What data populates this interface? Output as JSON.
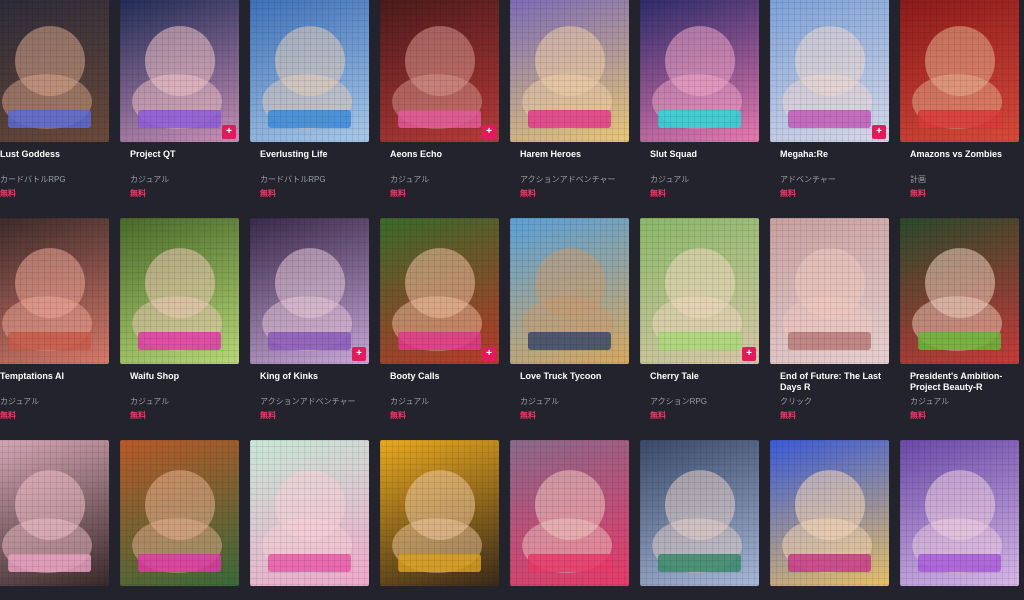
{
  "badge_glyph": "+",
  "rows": [
    [
      {
        "title": "Lust Goddess",
        "genre": "カードバトルRPG",
        "price": "無料",
        "badge": false,
        "bg": [
          "#2a2a3a",
          "#6b4a3a"
        ],
        "blob": "#d9a68a",
        "band": "#5a6bd8"
      },
      {
        "title": "Project QT",
        "genre": "カジュアル",
        "price": "無料",
        "badge": true,
        "bg": [
          "#1e2b55",
          "#c890b8"
        ],
        "blob": "#f2c4c8",
        "band": "#8c5ad8"
      },
      {
        "title": "Everlusting Life",
        "genre": "カードバトルRPG",
        "price": "無料",
        "badge": false,
        "bg": [
          "#3c6fb8",
          "#a9c9e8"
        ],
        "blob": "#e8cdb8",
        "band": "#3b8ad8"
      },
      {
        "title": "Aeons Echo",
        "genre": "カジュアル",
        "price": "無料",
        "badge": true,
        "bg": [
          "#4a1a1a",
          "#b83a3a"
        ],
        "blob": "#d89890",
        "band": "#e25a9a"
      },
      {
        "title": "Harem Heroes",
        "genre": "アクションアドベンチャー",
        "price": "無料",
        "badge": false,
        "bg": [
          "#7a6ab8",
          "#e8c878"
        ],
        "blob": "#f0d0a8",
        "band": "#e23a8a"
      },
      {
        "title": "Slut Squad",
        "genre": "カジュアル",
        "price": "無料",
        "badge": false,
        "bg": [
          "#2a2a6a",
          "#e87ab0"
        ],
        "blob": "#f2a8c8",
        "band": "#2ad8d8"
      },
      {
        "title": "Megaha:Re",
        "genre": "アドベンチャー",
        "price": "無料",
        "badge": true,
        "bg": [
          "#7aa0d8",
          "#d8d8e8"
        ],
        "blob": "#f0d8d0",
        "band": "#c05ab8"
      },
      {
        "title": "Amazons vs Zombies",
        "genre": "計画",
        "price": "無料",
        "badge": false,
        "bg": [
          "#8a1a1a",
          "#d84a3a"
        ],
        "blob": "#e8b090",
        "band": "#d83a3a"
      }
    ],
    [
      {
        "title": "Temptations AI",
        "genre": "カジュアル",
        "price": "無料",
        "badge": false,
        "bg": [
          "#3a2a2a",
          "#d87a6a"
        ],
        "blob": "#f0a898",
        "band": "#c85a4a"
      },
      {
        "title": "Waifu Shop",
        "genre": "カジュアル",
        "price": "無料",
        "badge": false,
        "bg": [
          "#4a6a2a",
          "#b8d878"
        ],
        "blob": "#f0c8b8",
        "band": "#e23aa8"
      },
      {
        "title": "King of Kinks",
        "genre": "アクションアドベンチャー",
        "price": "無料",
        "badge": true,
        "bg": [
          "#3a2a4a",
          "#c8a8d8"
        ],
        "blob": "#e8c8d8",
        "band": "#8a5ab8"
      },
      {
        "title": "Booty Calls",
        "genre": "カジュアル",
        "price": "無料",
        "badge": true,
        "bg": [
          "#3a6a2a",
          "#b83a2a"
        ],
        "blob": "#f0c0a0",
        "band": "#e23a8a"
      },
      {
        "title": "Love Truck Tycoon",
        "genre": "カジュアル",
        "price": "無料",
        "badge": false,
        "bg": [
          "#5aa0d8",
          "#d8a860"
        ],
        "blob": "#c89a70",
        "band": "#3a4a6a"
      },
      {
        "title": "Cherry Tale",
        "genre": "アクションRPG",
        "price": "無料",
        "badge": true,
        "bg": [
          "#8ab868",
          "#d8c8a8"
        ],
        "blob": "#f0d8c0",
        "band": "#a8d878"
      },
      {
        "title": "End of Future: The Last Days R",
        "genre": "クリック",
        "price": "無料",
        "badge": false,
        "bg": [
          "#c8a0a0",
          "#e8d0d0"
        ],
        "blob": "#f0c8c0",
        "band": "#b87a7a"
      },
      {
        "title": "President's Ambition-Project Beauty-R",
        "genre": "カジュアル",
        "price": "無料",
        "badge": false,
        "bg": [
          "#2a4a2a",
          "#c83a3a"
        ],
        "blob": "#f0d0c0",
        "band": "#6ab83a"
      }
    ],
    [
      {
        "title": "",
        "genre": "",
        "price": "",
        "badge": false,
        "bg": [
          "#d8a8b8",
          "#3a2a2a"
        ],
        "blob": "#f2c0c8",
        "band": "#e8a0c0"
      },
      {
        "title": "",
        "genre": "",
        "price": "",
        "badge": false,
        "bg": [
          "#b85a2a",
          "#3a6a3a"
        ],
        "blob": "#e8b090",
        "band": "#e23aa8"
      },
      {
        "title": "",
        "genre": "",
        "price": "",
        "badge": false,
        "bg": [
          "#c8e8d8",
          "#f0a8c8"
        ],
        "blob": "#f8d0d8",
        "band": "#e85aa8"
      },
      {
        "title": "",
        "genre": "",
        "price": "",
        "badge": false,
        "bg": [
          "#e8a820",
          "#3a2a1a"
        ],
        "blob": "#f0c8a0",
        "band": "#d8a020"
      },
      {
        "title": "",
        "genre": "",
        "price": "",
        "badge": false,
        "bg": [
          "#8a6a8a",
          "#e83a6a"
        ],
        "blob": "#f0c8c0",
        "band": "#e83a6a"
      },
      {
        "title": "",
        "genre": "",
        "price": "",
        "badge": false,
        "bg": [
          "#3a4a6a",
          "#a8b8d8"
        ],
        "blob": "#e8d0c8",
        "band": "#3a8a6a"
      },
      {
        "title": "",
        "genre": "",
        "price": "",
        "badge": false,
        "bg": [
          "#3a5ad8",
          "#e8c068"
        ],
        "blob": "#f8d8b8",
        "band": "#c83a8a"
      },
      {
        "title": "",
        "genre": "",
        "price": "",
        "badge": false,
        "bg": [
          "#6a4aa8",
          "#d8b8e8"
        ],
        "blob": "#f0d0e0",
        "band": "#a85ad8"
      }
    ]
  ]
}
